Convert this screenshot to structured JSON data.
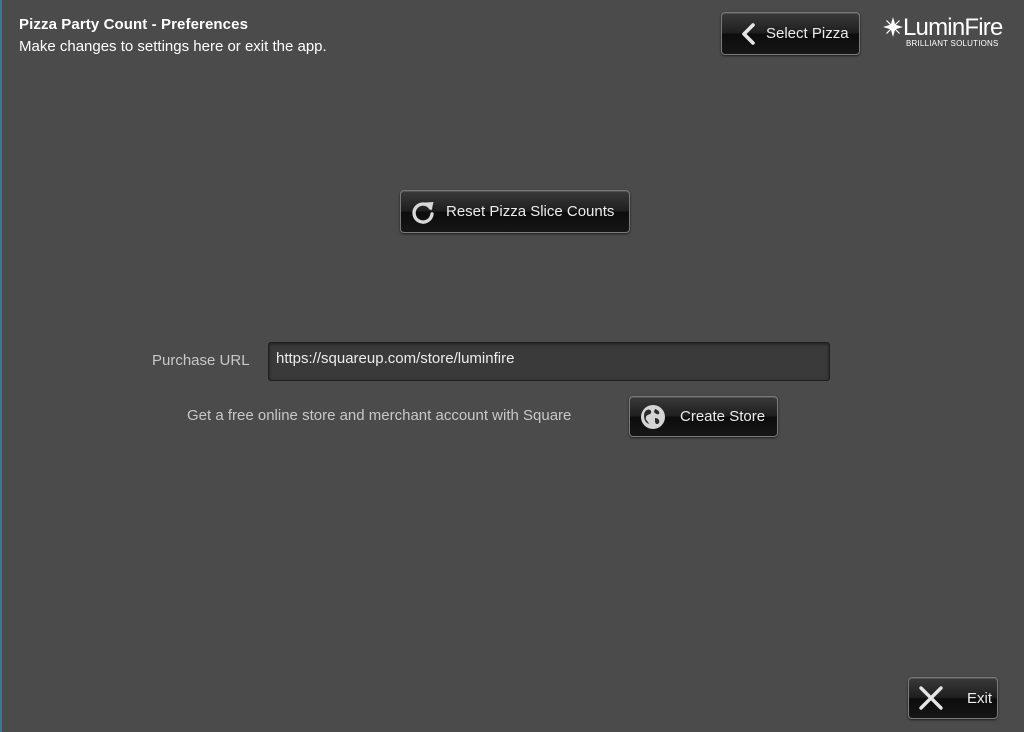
{
  "header": {
    "title": "Pizza Party Count - Preferences",
    "subtitle": "Make changes to settings here or exit the app."
  },
  "toolbar": {
    "select_pizza_label": "Select Pizza",
    "select_pizza_icon": "chevron-left-icon"
  },
  "logo": {
    "name": "LuminFire",
    "tagline": "BRILLIANT SOLUTIONS"
  },
  "actions": {
    "reset_label": "Reset Pizza Slice Counts",
    "reset_icon": "refresh-icon"
  },
  "purchase": {
    "label": "Purchase URL",
    "url_value": "https://squareup.com/store/luminfire",
    "store_text": "Get a free online store and merchant account with Square",
    "create_store_label": "Create Store",
    "create_store_icon": "globe-icon"
  },
  "footer": {
    "exit_label": "Exit",
    "exit_icon": "close-icon"
  },
  "colors": {
    "background": "#4b4b4b",
    "button_bg": "#1a1a1a",
    "text": "#ffffff",
    "muted_text": "#c8c8c8"
  }
}
